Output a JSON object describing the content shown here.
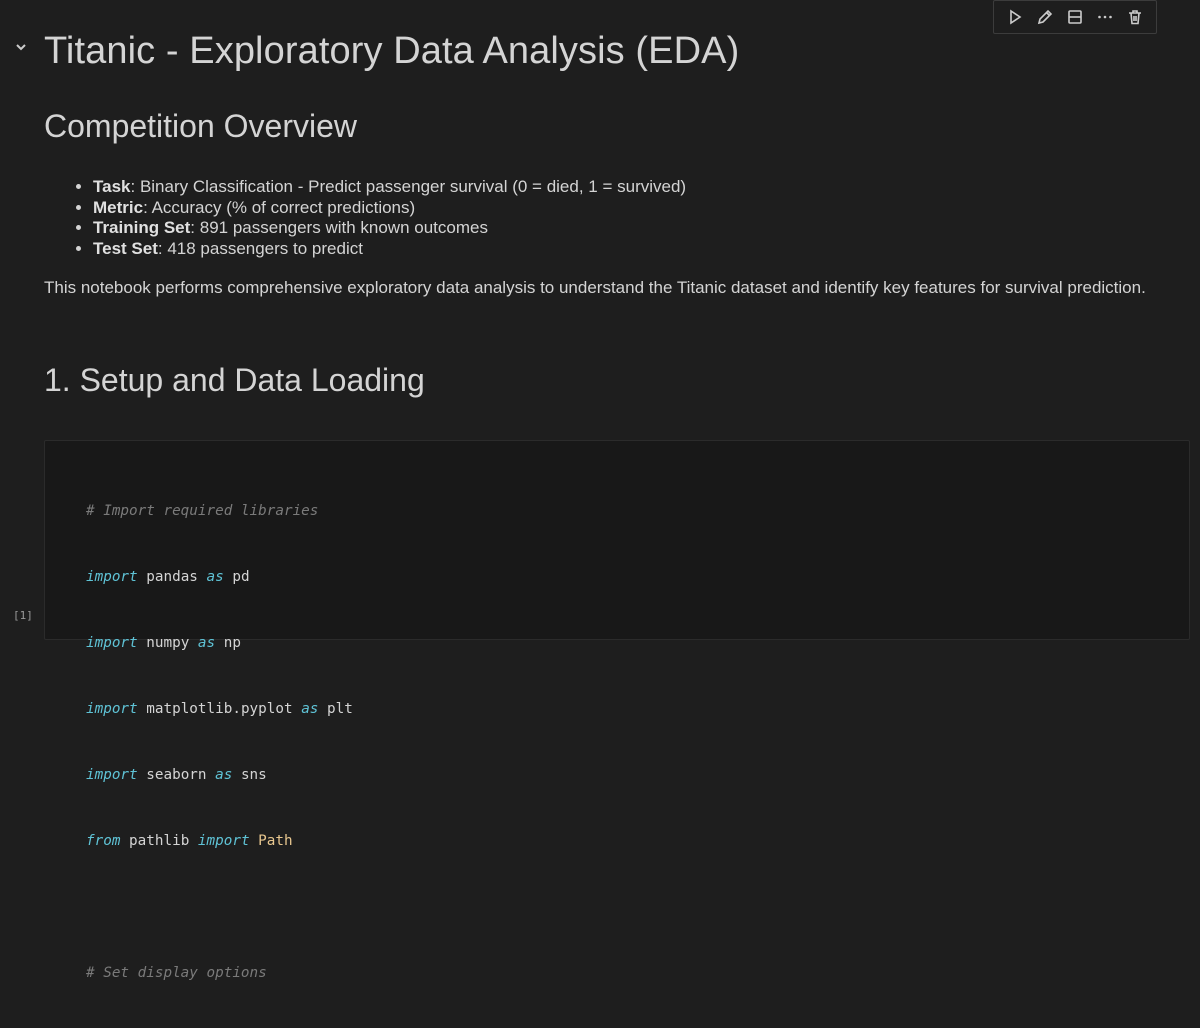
{
  "toolbar": {
    "buttons": [
      {
        "icon": "play-icon",
        "label": "Run"
      },
      {
        "icon": "pencil-icon",
        "label": "Edit"
      },
      {
        "icon": "split-cell-icon",
        "label": "Split"
      },
      {
        "icon": "more-icon",
        "label": "More"
      },
      {
        "icon": "trash-icon",
        "label": "Delete"
      }
    ]
  },
  "markdown": {
    "title": "Titanic - Exploratory Data Analysis (EDA)",
    "overview_heading": "Competition Overview",
    "bullets": [
      {
        "label": "Task",
        "text": ": Binary Classification - Predict passenger survival (0 = died, 1 = survived)"
      },
      {
        "label": "Metric",
        "text": ": Accuracy (% of correct predictions)"
      },
      {
        "label": "Training Set",
        "text": ": 891 passengers with known outcomes"
      },
      {
        "label": "Test Set",
        "text": ": 418 passengers to predict"
      }
    ],
    "paragraph": "This notebook performs comprehensive exploratory data analysis to understand the Titanic dataset and identify key features for survival prediction.",
    "setup_heading": "1. Setup and Data Loading"
  },
  "code_cell": {
    "execution_count": "[1]",
    "lines": [
      {
        "comment": "# Import required libraries"
      },
      {
        "kw1": "import",
        "mod": " pandas ",
        "kw2": "as",
        "alias": " pd"
      },
      {
        "kw1": "import",
        "mod": " numpy ",
        "kw2": "as",
        "alias": " np"
      },
      {
        "kw1": "import",
        "mod": " matplotlib.pyplot ",
        "kw2": "as",
        "alias": " plt"
      },
      {
        "kw1": "import",
        "mod": " seaborn ",
        "kw2": "as",
        "alias": " sns"
      },
      {
        "kw1": "from",
        "mod": " pathlib ",
        "kw2": "import",
        "cls": " Path"
      },
      {
        "blank": ""
      },
      {
        "comment": "# Set display options"
      }
    ]
  },
  "colors": {
    "background": "#1e1e1e",
    "keyword": "#5fc3d6",
    "class": "#e8c78f",
    "comment": "#7a7a7a"
  }
}
